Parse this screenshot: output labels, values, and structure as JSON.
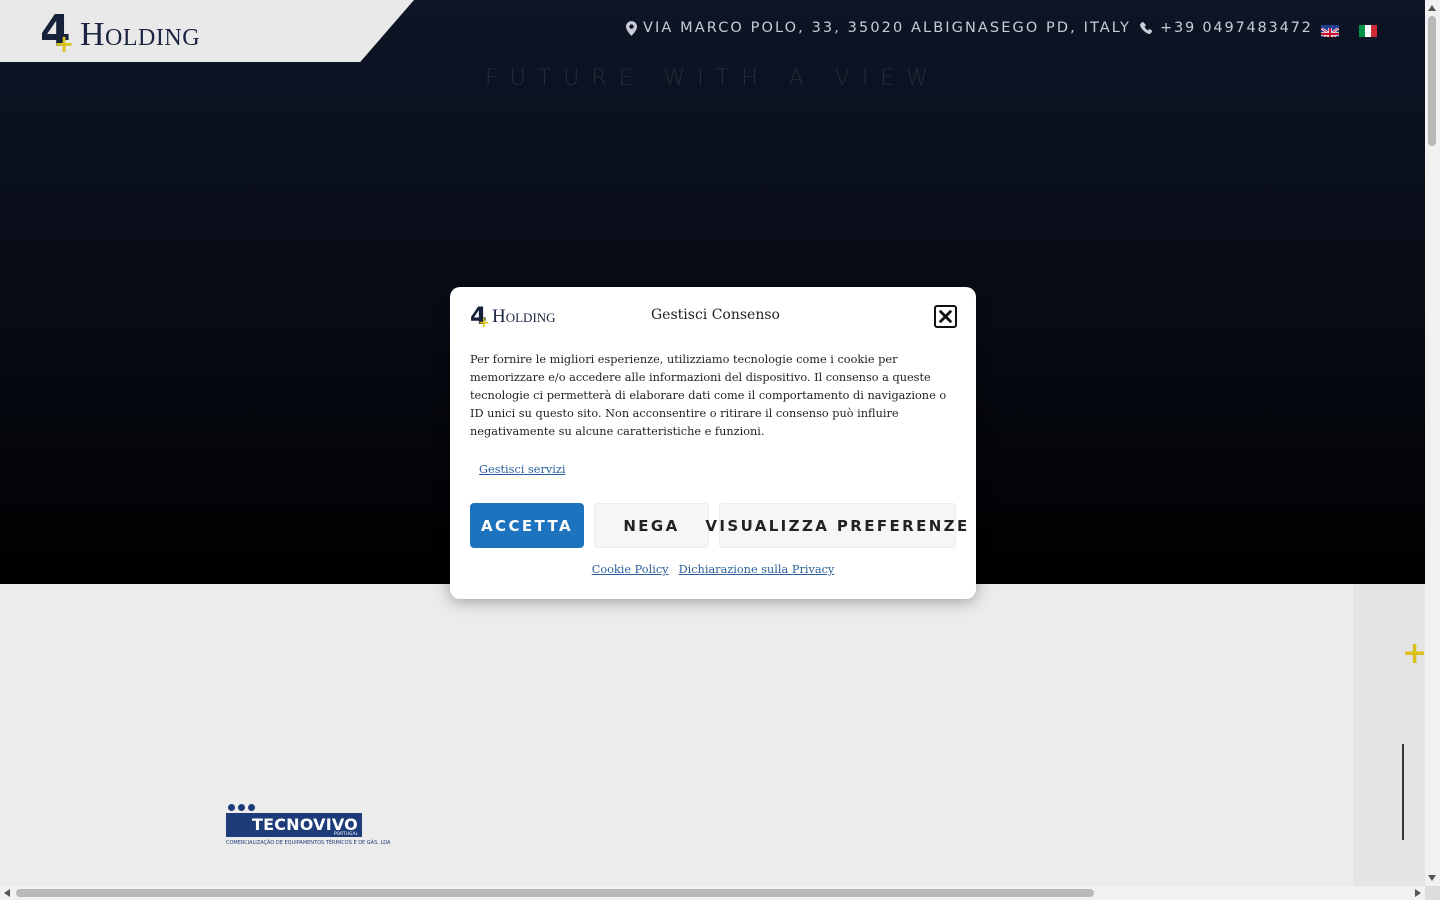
{
  "header": {
    "logo_number": "4",
    "logo_text": "Holding",
    "address": "VIA MARCO POLO, 33, 35020 ALBIGNASEGO PD, ITALY",
    "phone": "+39 0497483472",
    "icons": {
      "address": "map-pin-icon",
      "phone": "phone-icon"
    },
    "languages": [
      "en",
      "it"
    ]
  },
  "hero": {
    "tagline": "FUTURE WITH A VIEW"
  },
  "partner_logo": {
    "name": "TECNOVIVO",
    "country": "PORTUGAL",
    "subtitle": "COMERCIALIZAÇÃO DE EQUIPAMENTOS TÉRMICOS E DE GÁS, LDA"
  },
  "consent": {
    "logo_number": "4",
    "logo_text": "Holding",
    "title": "Gestisci Consenso",
    "body": "Per fornire le migliori esperienze, utilizziamo tecnologie come i cookie per memorizzare e/o accedere alle informazioni del dispositivo. Il consenso a queste tecnologie ci permetterà di elaborare dati come il comportamento di navigazione o ID unici su questo sito. Non acconsentire o ritirare il consenso può influire negativamente su alcune caratteristiche e funzioni.",
    "manage_services": "Gestisci servizi",
    "accept": "ACCETTA",
    "deny": "NEGA",
    "preferences": "VISUALIZZA PREFERENZE",
    "cookie_policy": "Cookie Policy",
    "privacy": "Dichiarazione sulla Privacy"
  },
  "colors": {
    "accent_blue": "#1e73be",
    "brand_navy": "#16213a",
    "brand_yellow": "#d8c21b"
  }
}
